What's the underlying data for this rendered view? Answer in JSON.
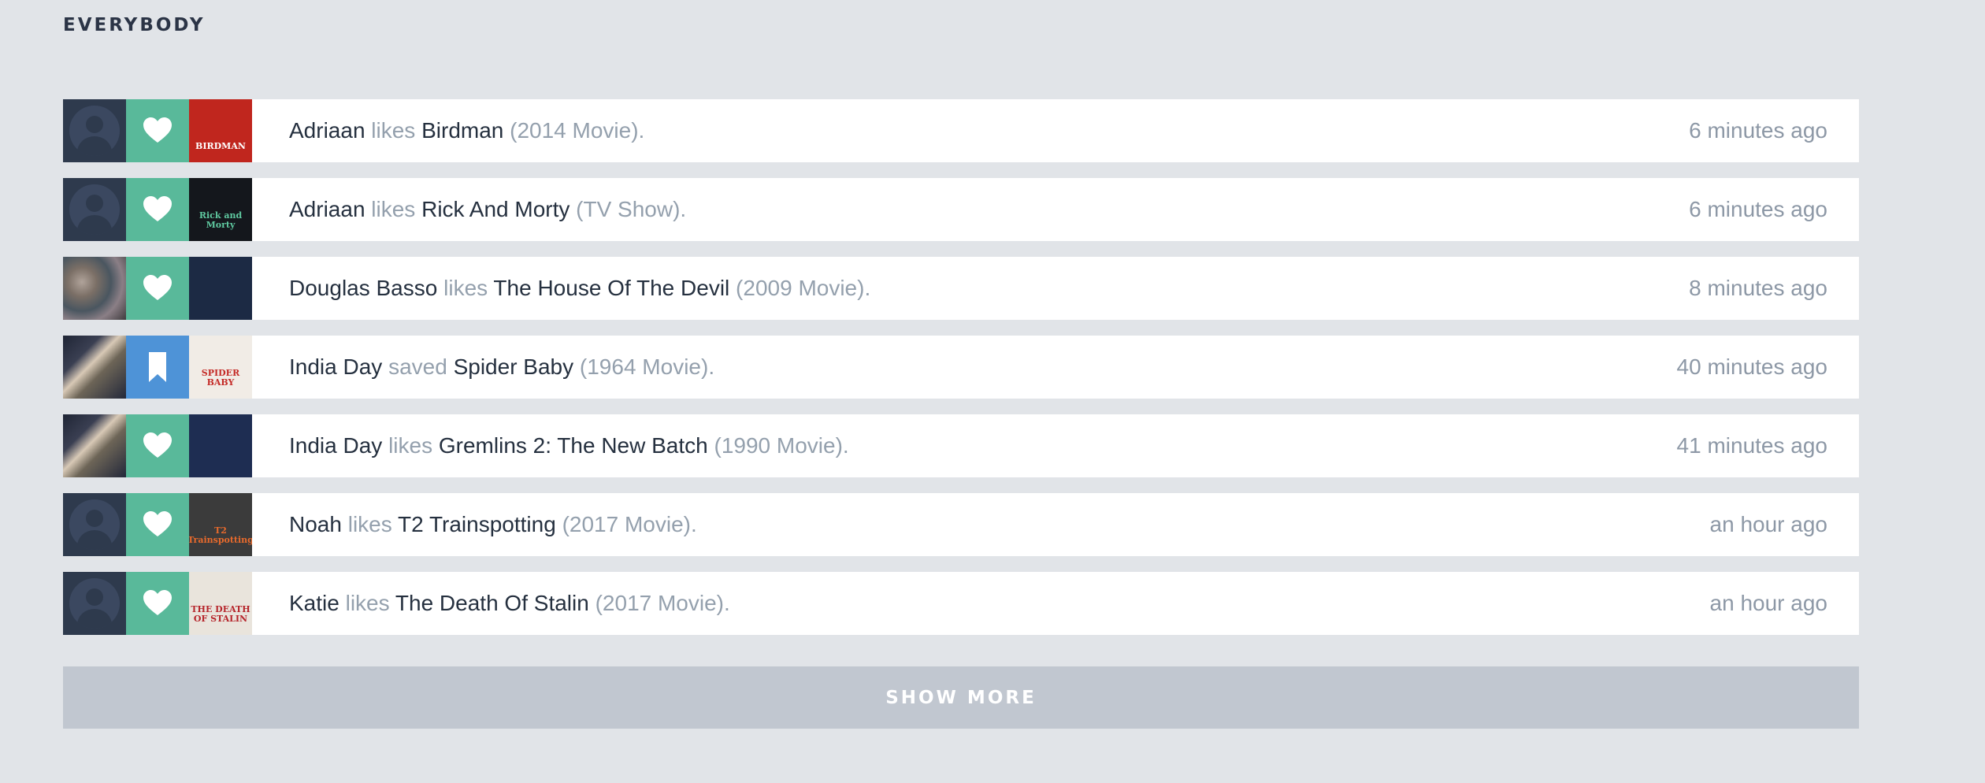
{
  "section": {
    "title": "EVERYBODY"
  },
  "feed": [
    {
      "user": "Adriaan",
      "verb": "likes",
      "item": "Birdman",
      "meta": "(2014 Movie).",
      "time": "6 minutes ago",
      "action": "like",
      "avatar": "default",
      "poster": {
        "title": "BIRDMAN",
        "bg": "#c0261e",
        "fg": "#ffffff"
      }
    },
    {
      "user": "Adriaan",
      "verb": "likes",
      "item": "Rick And Morty",
      "meta": "(TV Show).",
      "time": "6 minutes ago",
      "action": "like",
      "avatar": "default",
      "poster": {
        "title": "Rick and Morty",
        "bg": "#14171c",
        "fg": "#5fc9a0"
      }
    },
    {
      "user": "Douglas Basso",
      "verb": "likes",
      "item": "The House Of The Devil",
      "meta": "(2009 Movie).",
      "time": "8 minutes ago",
      "action": "like",
      "avatar": "photo-a",
      "poster": {
        "title": "",
        "bg": "#1c2a44",
        "fg": "#e4a34a"
      }
    },
    {
      "user": "India Day",
      "verb": "saved",
      "item": "Spider Baby",
      "meta": "(1964 Movie).",
      "time": "40 minutes ago",
      "action": "save",
      "avatar": "photo-b",
      "poster": {
        "title": "SPIDER BABY",
        "bg": "#f1ece6",
        "fg": "#c42a26"
      }
    },
    {
      "user": "India Day",
      "verb": "likes",
      "item": "Gremlins 2: The New Batch",
      "meta": "(1990 Movie).",
      "time": "41 minutes ago",
      "action": "like",
      "avatar": "photo-b",
      "poster": {
        "title": "",
        "bg": "#1e2d52",
        "fg": "#cf3b46"
      }
    },
    {
      "user": "Noah",
      "verb": "likes",
      "item": "T2 Trainspotting",
      "meta": "(2017 Movie).",
      "time": "an hour ago",
      "action": "like",
      "avatar": "default",
      "poster": {
        "title": "T2 Trainspotting",
        "bg": "#3b3b3b",
        "fg": "#e86a2c"
      }
    },
    {
      "user": "Katie",
      "verb": "likes",
      "item": "The Death Of Stalin",
      "meta": "(2017 Movie).",
      "time": "an hour ago",
      "action": "like",
      "avatar": "default",
      "poster": {
        "title": "THE DEATH OF STALIN",
        "bg": "#e9e4dc",
        "fg": "#b5242a"
      }
    }
  ],
  "show_more": {
    "label": "SHOW MORE"
  },
  "colors": {
    "background": "#e1e4e8",
    "like": "#59b99a",
    "save": "#4e93d7",
    "button": "#c1c7d0"
  },
  "icons": {
    "like": "heart-icon",
    "save": "bookmark-icon"
  }
}
